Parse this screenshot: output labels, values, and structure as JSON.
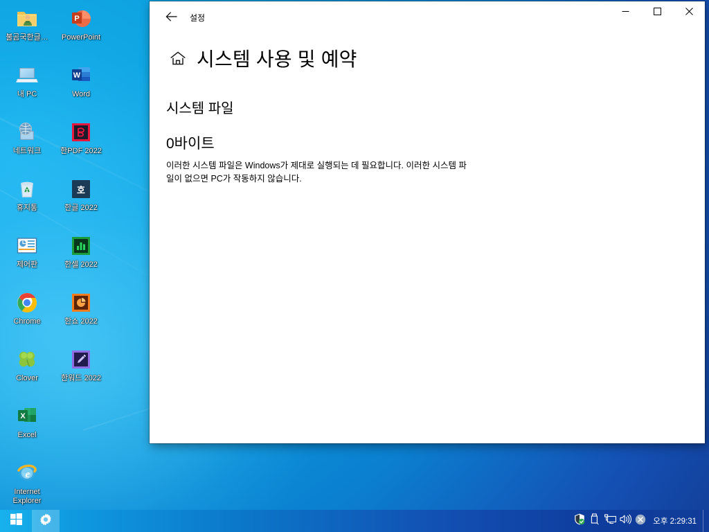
{
  "desktop": {
    "icons_col1": [
      {
        "label": "불곰국한글…",
        "icon": "folder-user-icon"
      },
      {
        "label": "내 PC",
        "icon": "this-pc-icon"
      },
      {
        "label": "네트워크",
        "icon": "network-icon"
      },
      {
        "label": "휴지통",
        "icon": "recycle-bin-icon"
      },
      {
        "label": "제어판",
        "icon": "control-panel-icon"
      },
      {
        "label": "Chrome",
        "icon": "chrome-icon"
      },
      {
        "label": "Clover",
        "icon": "clover-icon"
      },
      {
        "label": "Excel",
        "icon": "excel-icon"
      },
      {
        "label": "Internet Explorer",
        "icon": "internet-explorer-icon"
      }
    ],
    "icons_col2": [
      {
        "label": "PowerPoint",
        "icon": "powerpoint-icon"
      },
      {
        "label": "Word",
        "icon": "word-icon"
      },
      {
        "label": "한PDF 2022",
        "icon": "hanpdf-icon"
      },
      {
        "label": "한글 2022",
        "icon": "hangul-icon"
      },
      {
        "label": "한셀 2022",
        "icon": "hancell-icon"
      },
      {
        "label": "한쇼 2022",
        "icon": "hanshow-icon"
      },
      {
        "label": "한워드 2022",
        "icon": "hanword-icon"
      }
    ]
  },
  "taskbar": {
    "start_label": "start-button",
    "pinned": [
      {
        "name": "settings-taskbar-button",
        "icon": "gear-icon",
        "active": true
      }
    ],
    "tray": [
      {
        "name": "tray-defender",
        "icon": "shield-check-icon"
      },
      {
        "name": "tray-usb-eject",
        "icon": "usb-eject-icon"
      },
      {
        "name": "tray-network",
        "icon": "network-monitor-icon"
      },
      {
        "name": "tray-volume",
        "icon": "speaker-icon"
      },
      {
        "name": "tray-error",
        "icon": "error-circle-icon"
      }
    ],
    "clock": "오후 2:29:31"
  },
  "window": {
    "title": "설정",
    "back_icon": "back-arrow-icon",
    "controls": {
      "minimize": "minimize-icon",
      "maximize": "maximize-icon",
      "close": "close-icon"
    },
    "home_icon": "home-icon",
    "page_title": "시스템 사용 및 예약",
    "section_heading": "시스템 파일",
    "size_value": "0바이트",
    "description": "이러한 시스템 파일은 Windows가 제대로 실행되는 데 필요합니다. 이러한 시스템 파일이 없으면 PC가 작동하지 않습니다."
  },
  "colors": {
    "desktop_light": "#19b4ef",
    "desktop_dark": "#12398f",
    "taskbar_left": "#18b2ed",
    "taskbar_right": "#113c99",
    "window_bg": "#ffffff",
    "text": "#000000",
    "close_hover": "#e81123"
  }
}
